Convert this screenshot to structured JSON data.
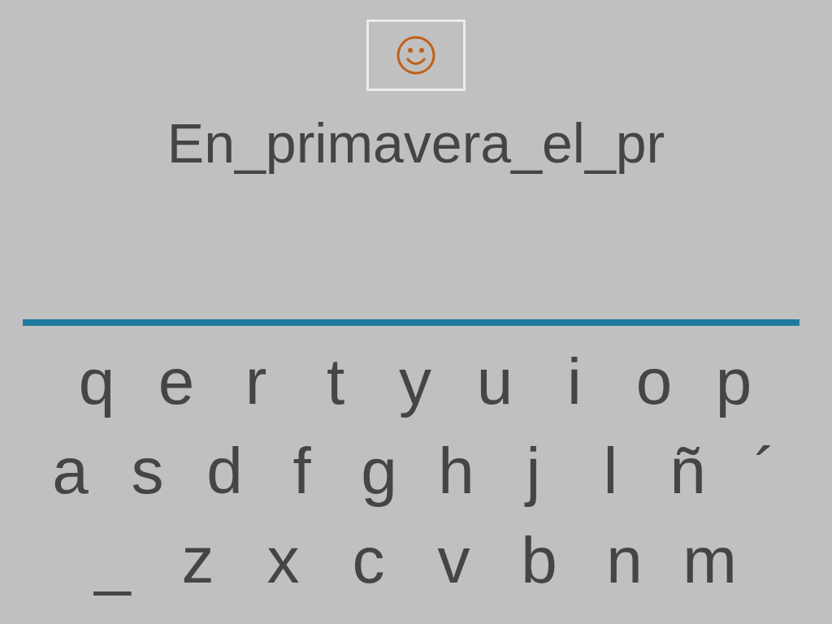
{
  "title": "En_primavera_el_pr",
  "rows": [
    [
      "q",
      "e",
      "r",
      "t",
      "y",
      "u",
      "i",
      "o",
      "p"
    ],
    [
      "a",
      "s",
      "d",
      "f",
      "g",
      "h",
      "j",
      "l",
      "ñ",
      "´"
    ],
    [
      "_",
      "z",
      "x",
      "c",
      "v",
      "b",
      "n",
      "m"
    ]
  ]
}
